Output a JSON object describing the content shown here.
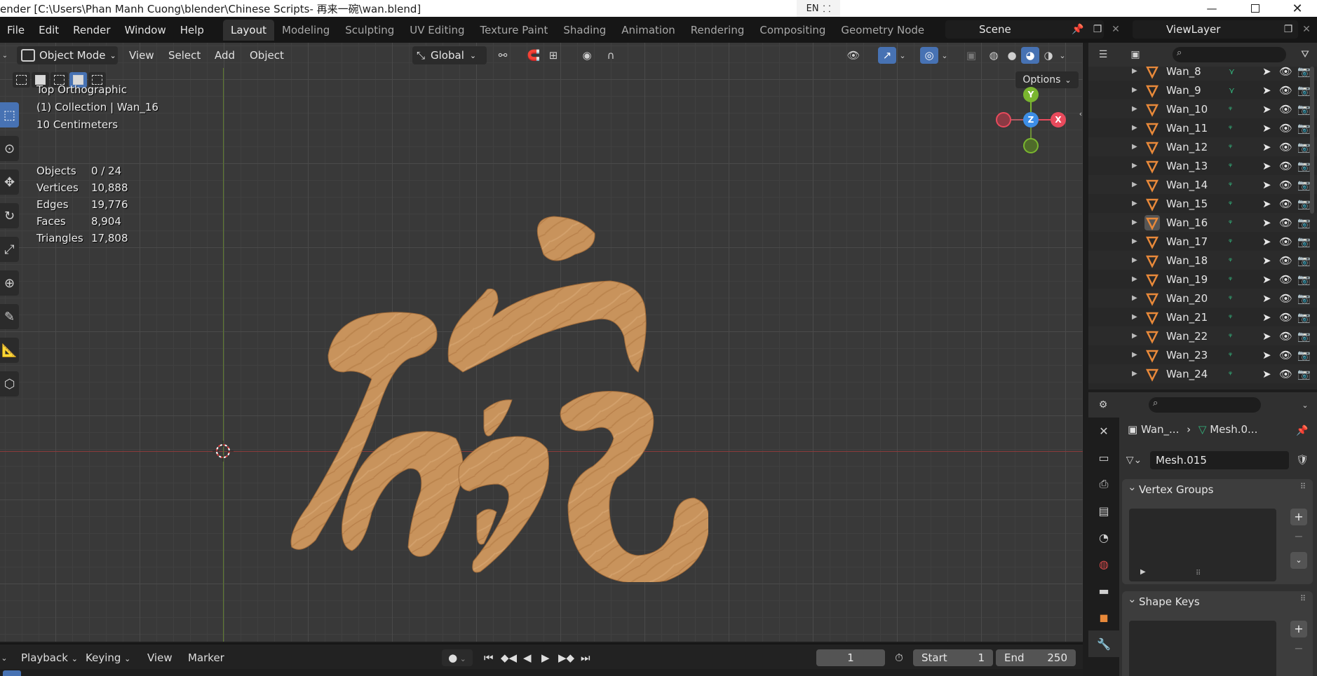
{
  "window": {
    "title": "ender [C:\\Users\\Phan Manh Cuong\\blender\\Chinese Scripts- 再来一碗\\wan.blend]",
    "lang": "EN"
  },
  "menu": [
    "File",
    "Edit",
    "Render",
    "Window",
    "Help"
  ],
  "workspaces": [
    "Layout",
    "Modeling",
    "Sculpting",
    "UV Editing",
    "Texture Paint",
    "Shading",
    "Animation",
    "Rendering",
    "Compositing",
    "Geometry Node"
  ],
  "scene": "Scene",
  "view_layer": "ViewLayer",
  "viewport": {
    "mode": "Object Mode",
    "menus": [
      "View",
      "Select",
      "Add",
      "Object"
    ],
    "orientation": "Global",
    "options": "Options",
    "view_name": "Top Orthographic",
    "collection_line": "(1) Collection | Wan_16",
    "scale_line": "10 Centimeters",
    "stats": [
      {
        "label": "Objects",
        "value": "0 / 24"
      },
      {
        "label": "Vertices",
        "value": "10,888"
      },
      {
        "label": "Edges",
        "value": "19,776"
      },
      {
        "label": "Faces",
        "value": "8,904"
      },
      {
        "label": "Triangles",
        "value": "17,808"
      }
    ],
    "gizmo": {
      "x": "X",
      "y": "Y",
      "z": "Z"
    },
    "colors": {
      "x_axis": "#e94a5c",
      "y_axis": "#7ab62f",
      "z_axis": "#3d8ee6",
      "wood": "#c8935c"
    }
  },
  "timeline": {
    "menus": [
      "Playback",
      "Keying",
      "View",
      "Marker"
    ],
    "current_frame": "1",
    "start_label": "Start",
    "start": "1",
    "end_label": "End",
    "end": "250"
  },
  "outliner": {
    "items": [
      "Wan_8",
      "Wan_9",
      "Wan_10",
      "Wan_11",
      "Wan_12",
      "Wan_13",
      "Wan_14",
      "Wan_15",
      "Wan_16",
      "Wan_17",
      "Wan_18",
      "Wan_19",
      "Wan_20",
      "Wan_21",
      "Wan_22",
      "Wan_23",
      "Wan_24"
    ],
    "selected": "Wan_16"
  },
  "properties": {
    "object": "Wan_...",
    "mesh": "Mesh.0...",
    "mesh_name": "Mesh.015",
    "panel_vertex_groups": "Vertex Groups",
    "panel_shape_keys": "Shape Keys"
  }
}
